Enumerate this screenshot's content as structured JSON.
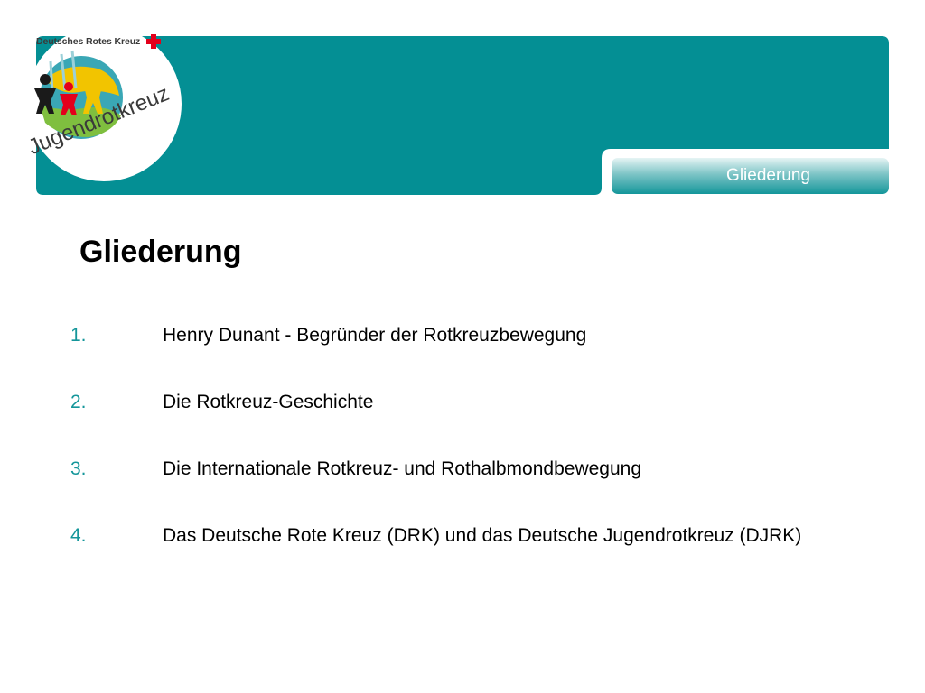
{
  "logo": {
    "brand_text": "Deutsches Rotes Kreuz",
    "name_text": "Jugendrotkreuz"
  },
  "header": {
    "tab_label": "Gliederung"
  },
  "slide": {
    "title": "Gliederung",
    "items": [
      {
        "number": "1.",
        "text": "Henry Dunant - Begründer der Rotkreuzbewegung"
      },
      {
        "number": "2.",
        "text": "Die Rotkreuz-Geschichte"
      },
      {
        "number": "3.",
        "text": "Die Internationale Rotkreuz- und Rothalbmondbewegung"
      },
      {
        "number": "4.",
        "text": "Das Deutsche Rote Kreuz (DRK) und das Deutsche Jugendrotkreuz (DJRK)"
      }
    ]
  },
  "colors": {
    "teal": "#048f94",
    "number": "#14969a",
    "red": "#e3001b"
  }
}
